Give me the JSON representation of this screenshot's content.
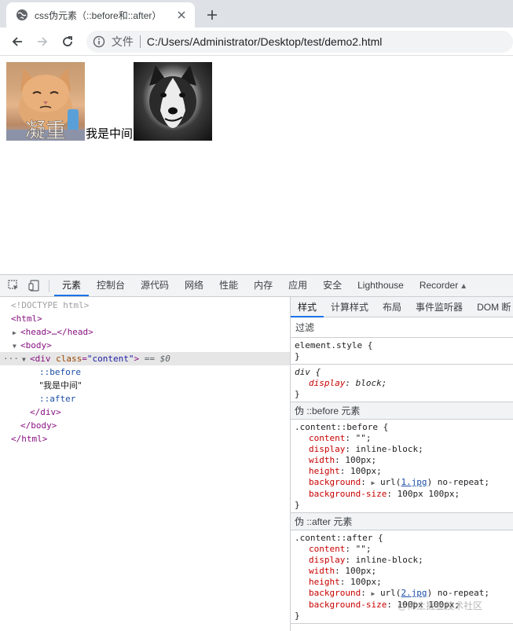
{
  "browser": {
    "tab_title": "css伪元素（::before和::after）",
    "omnibox_file_label": "文件",
    "url": "C:/Users/Administrator/Desktop/test/demo2.html"
  },
  "page": {
    "middle_text": "我是中间",
    "before_image_caption": "凝重"
  },
  "devtools": {
    "tabs": [
      "元素",
      "控制台",
      "源代码",
      "网络",
      "性能",
      "内存",
      "应用",
      "安全",
      "Lighthouse",
      "Recorder"
    ],
    "active_tab": "元素",
    "dom": {
      "doctype": "<!DOCTYPE html>",
      "html_open": "<html>",
      "head_collapsed": "<head>…</head>",
      "body_open": "<body>",
      "div_tag_open": "<div",
      "div_attr_name": "class",
      "div_attr_value": "\"content\"",
      "div_tag_close": ">",
      "selected_marker": "== $0",
      "ellipsis": "···",
      "before": "::before",
      "text_node": "\"我是中间\"",
      "after": "::after",
      "div_close": "</div>",
      "body_close": "</body>",
      "html_close": "</html>"
    },
    "styles_tabs": [
      "样式",
      "计算样式",
      "布局",
      "事件监听器",
      "DOM 断"
    ],
    "styles_active_tab": "样式",
    "filter_label": "过滤",
    "element_style": {
      "selector": "element.style {",
      "close": "}"
    },
    "div_rule": {
      "selector": "div {",
      "prop": "display",
      "value": "block;",
      "close": "}"
    },
    "before_section_header": "伪 ::before 元素",
    "before_rule": {
      "selector": ".content::before {",
      "content": "\"\";",
      "display": "inline-block;",
      "width": "100px;",
      "height": "100px;",
      "background_prefix": "url(",
      "background_link": "1.jpg",
      "background_suffix": ") no-repeat;",
      "background_size": "100px 100px;",
      "close": "}"
    },
    "after_section_header": "伪 ::after 元素",
    "after_rule": {
      "selector": ".content::after {",
      "content": "\"\";",
      "display": "inline-block;",
      "width": "100px;",
      "height": "100px;",
      "background_prefix": "url(",
      "background_link": "2.jpg",
      "background_suffix": ") no-repeat;",
      "background_size": "100px 100px;",
      "close": "}"
    },
    "prop_names": {
      "content": "content",
      "display": "display",
      "width": "width",
      "height": "height",
      "background": "background",
      "background_size": "background-size"
    }
  },
  "watermark": "@稀土掘金技术社区",
  "colors": {
    "accent": "#1a73e8",
    "tag": "#881280",
    "attr": "#994500",
    "attr_value": "#1a1aa6",
    "css_prop": "#c80000"
  }
}
